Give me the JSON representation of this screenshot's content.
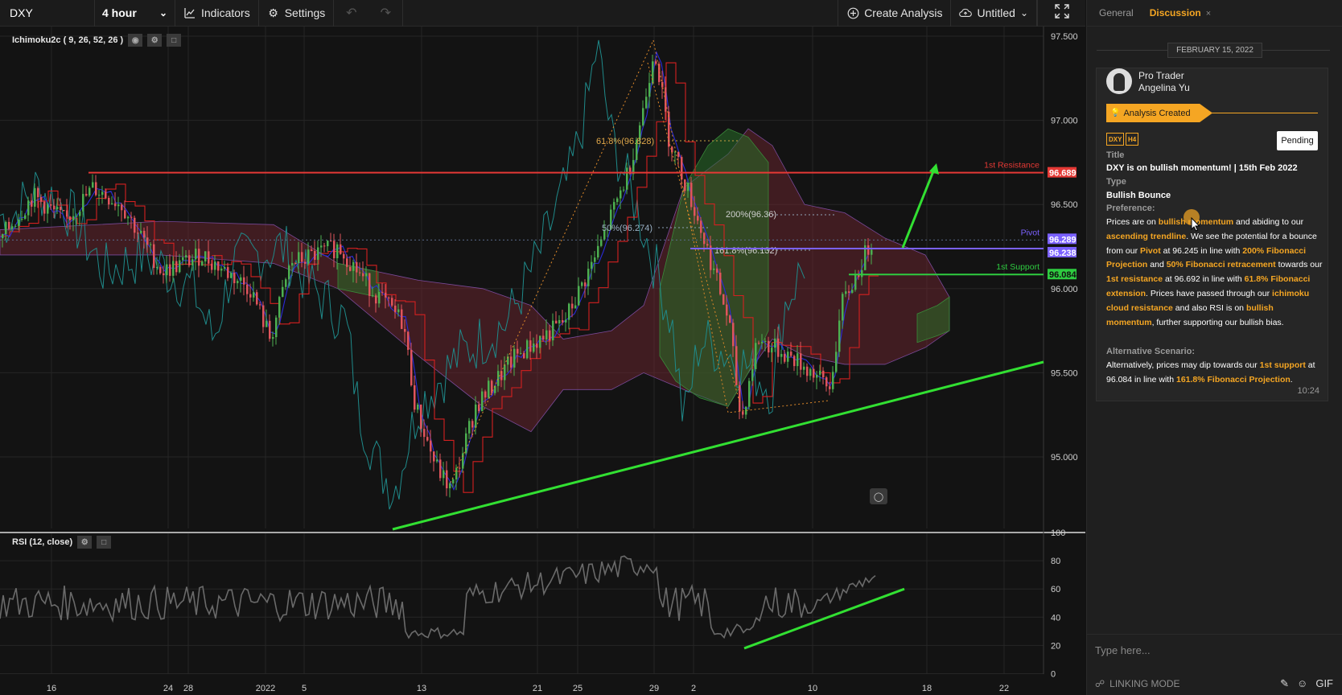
{
  "toolbar": {
    "symbol": "DXY",
    "interval": "4 hour",
    "indicators_label": "Indicators",
    "settings_label": "Settings",
    "create_analysis_label": "Create Analysis",
    "untitled_label": "Untitled"
  },
  "chart": {
    "ichimoku_label": "Ichimoku2c ( 9, 26, 52, 26 )",
    "rsi_label": "RSI (12, close)",
    "price_ticks": [
      "97.500",
      "97.000",
      "96.500",
      "96.000",
      "95.500",
      "95.000"
    ],
    "rsi_ticks": [
      "100",
      "80",
      "60",
      "40",
      "20",
      "0"
    ],
    "date_ticks": [
      "16",
      "24",
      "28",
      "2022",
      "5",
      "13",
      "21",
      "25",
      "29",
      "2",
      "10",
      "18",
      "22"
    ],
    "levels": [
      {
        "name": "1st Resistance",
        "value": "96.689",
        "color": "#e53935"
      },
      {
        "name": "Pivot",
        "value": "96.289",
        "color": "#7b61ff"
      },
      {
        "name": "",
        "value": "96.238",
        "color": "#7b61ff"
      },
      {
        "name": "1st Support",
        "value": "96.084",
        "color": "#2ecc40"
      }
    ],
    "fib_labels": [
      "61.8%(96.828)",
      "50%(96.274)",
      "200%(96.36)",
      "161.8%(96.132)"
    ]
  },
  "chart_data": {
    "type": "line",
    "title": "DXY",
    "ylim": [
      94.6,
      97.55
    ],
    "yticks": [
      95.0,
      95.5,
      96.0,
      96.5,
      97.0,
      97.5
    ],
    "xticks": [
      "16",
      "24",
      "28",
      "2022",
      "5",
      "13",
      "21",
      "25",
      "29",
      "2",
      "10",
      "18",
      "22"
    ],
    "series": [
      {
        "name": "1st Resistance",
        "values": [
          96.689
        ]
      },
      {
        "name": "Pivot",
        "values": [
          96.289
        ]
      },
      {
        "name": "1st Support",
        "values": [
          96.084
        ]
      }
    ],
    "rsi": {
      "name": "RSI (12, close)",
      "ylim": [
        0,
        100
      ],
      "yticks": [
        0,
        20,
        40,
        60,
        80,
        100
      ]
    }
  },
  "panel": {
    "tab_general": "General",
    "tab_discussion": "Discussion",
    "tab_close": "×",
    "date": "FEBRUARY 15, 2022",
    "role": "Pro Trader",
    "user": "Angelina Yu",
    "badge": "Analysis Created",
    "tag1": "DXY",
    "tag2": "H4",
    "status": "Pending",
    "title_label": "Title",
    "title_value": "DXY is on bullish momentum! | 15th Feb 2022",
    "type_label": "Type",
    "type_value": "Bullish Bounce",
    "preference_label": "Preference:",
    "alt_label": "Alternative Scenario:",
    "time": "10:24",
    "input_placeholder": "Type here...",
    "linking_mode": "LINKING MODE",
    "gif_label": "GIF"
  },
  "colors": {
    "accent": "#f5a623",
    "resistance": "#e53935",
    "support": "#2ecc40",
    "pivot": "#7b61ff"
  }
}
